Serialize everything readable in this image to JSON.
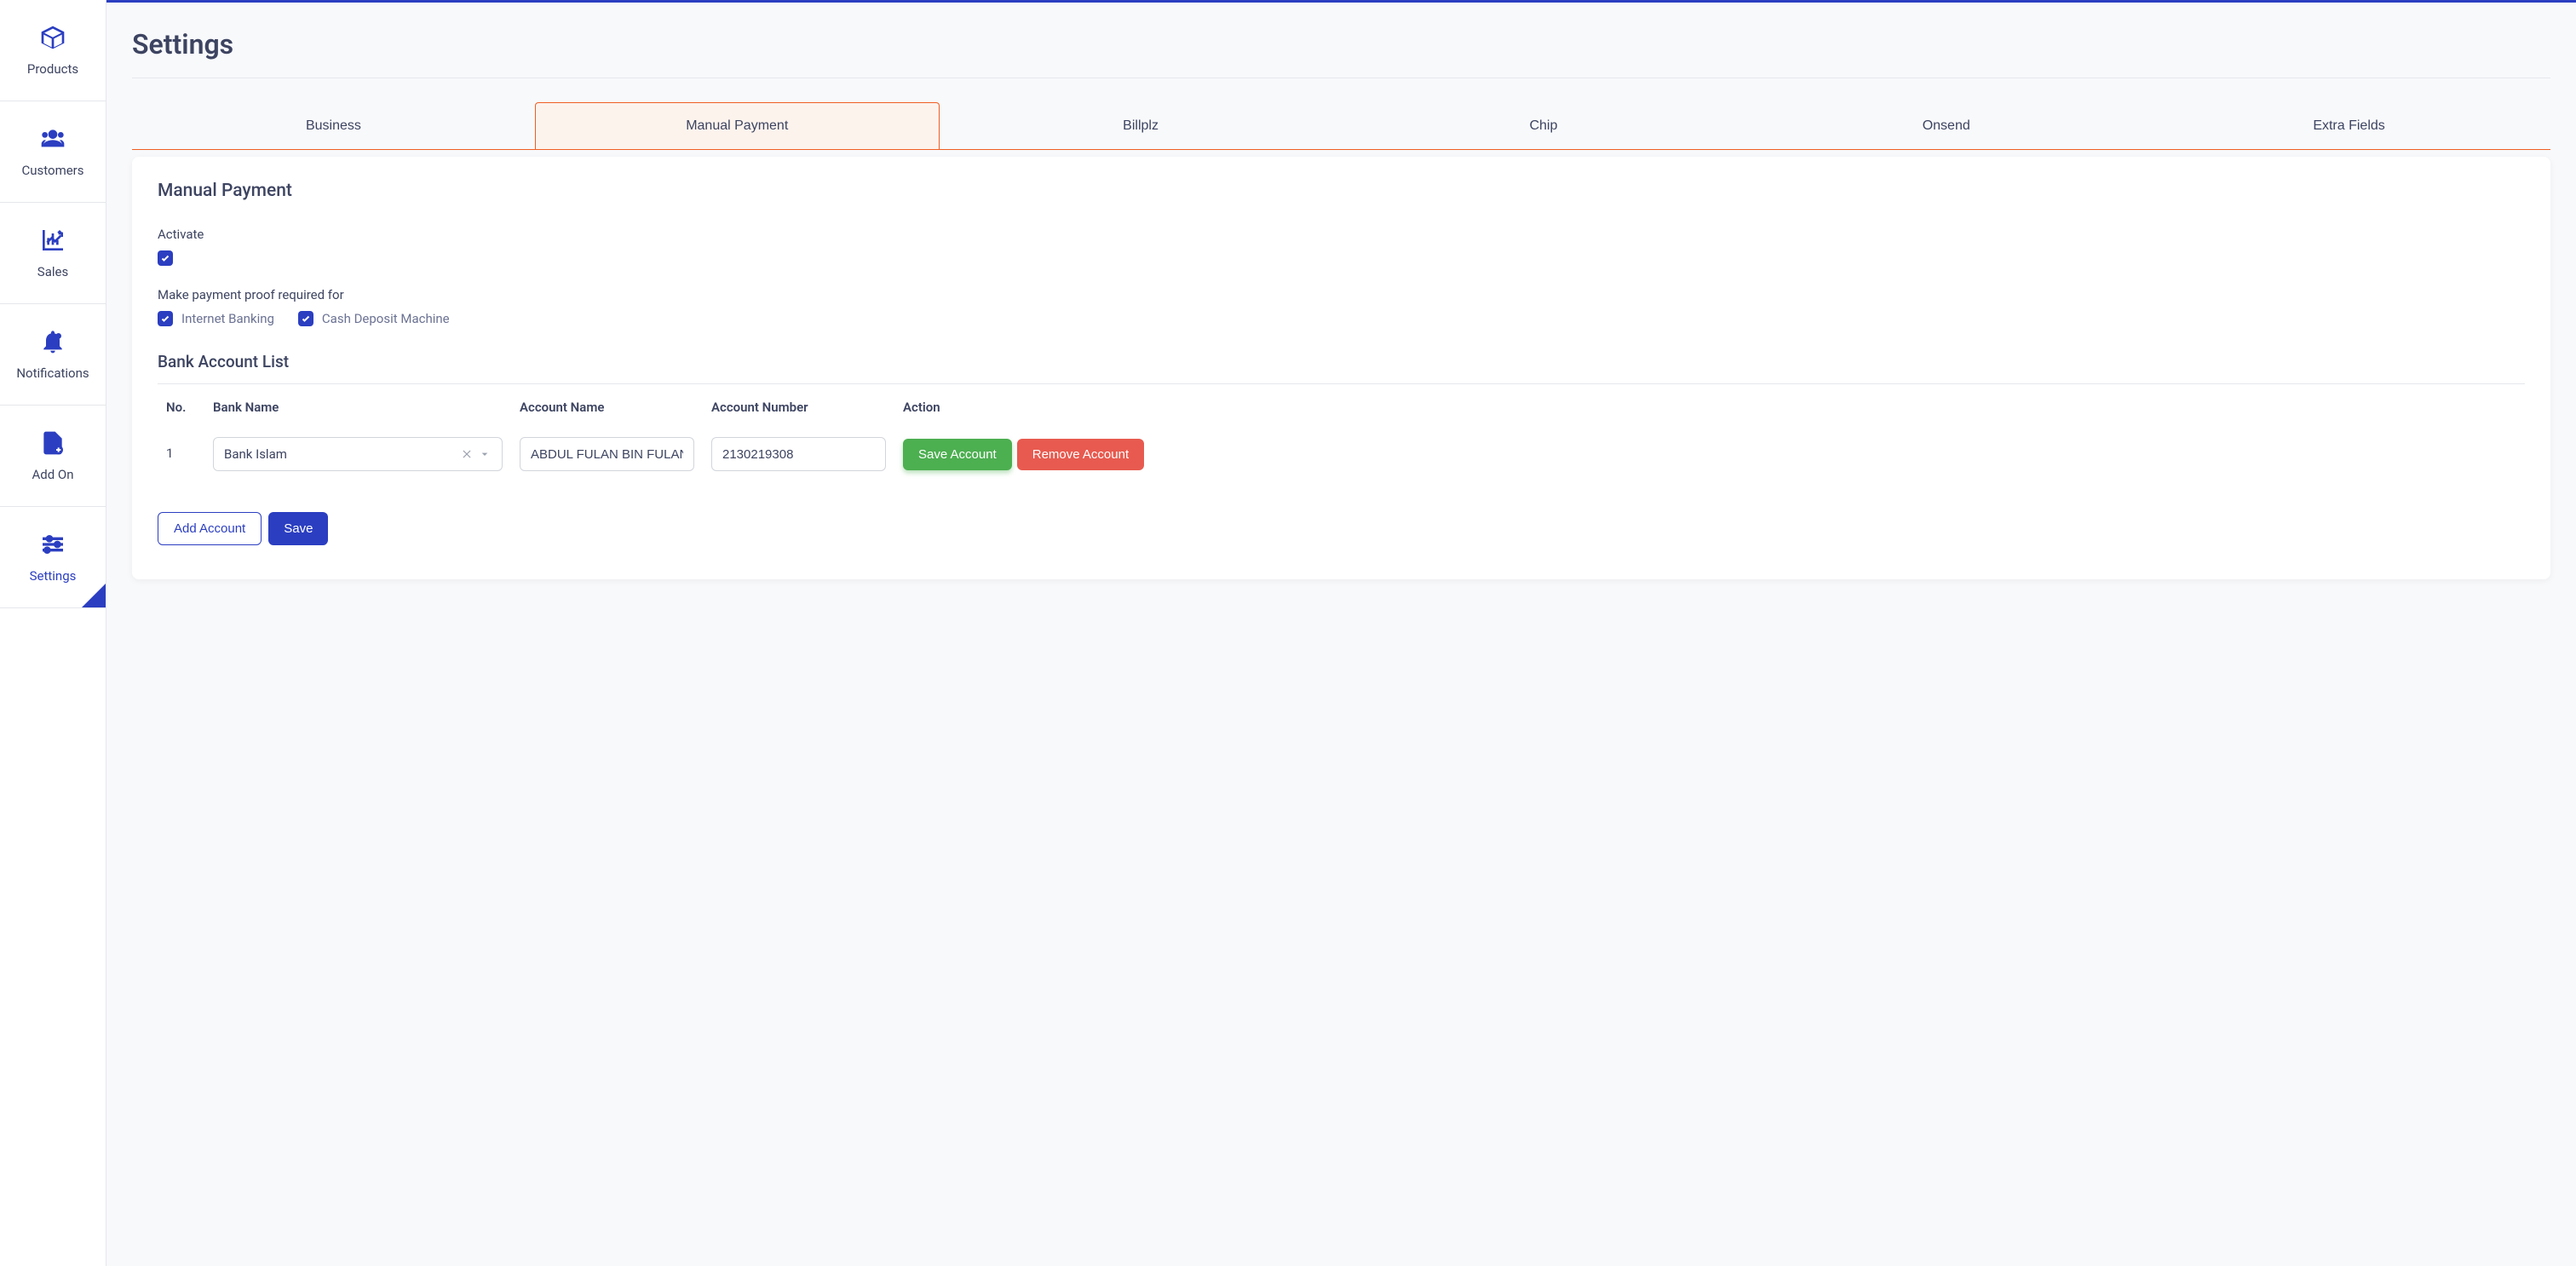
{
  "sidebar": {
    "items": [
      {
        "label": "Products",
        "icon": "box"
      },
      {
        "label": "Customers",
        "icon": "users"
      },
      {
        "label": "Sales",
        "icon": "chart"
      },
      {
        "label": "Notifications",
        "icon": "bell"
      },
      {
        "label": "Add On",
        "icon": "file-plus"
      },
      {
        "label": "Settings",
        "icon": "sliders",
        "active": true
      }
    ]
  },
  "page": {
    "title": "Settings"
  },
  "tabs": [
    {
      "label": "Business"
    },
    {
      "label": "Manual Payment",
      "active": true
    },
    {
      "label": "Billplz"
    },
    {
      "label": "Chip"
    },
    {
      "label": "Onsend"
    },
    {
      "label": "Extra Fields"
    }
  ],
  "manual_payment": {
    "title": "Manual Payment",
    "activate": {
      "label": "Activate",
      "checked": true
    },
    "proof_required": {
      "label": "Make payment proof required for",
      "options": [
        {
          "label": "Internet Banking",
          "checked": true
        },
        {
          "label": "Cash Deposit Machine",
          "checked": true
        }
      ]
    },
    "bank_list": {
      "title": "Bank Account List",
      "headers": {
        "no": "No.",
        "bank_name": "Bank Name",
        "account_name": "Account Name",
        "account_number": "Account Number",
        "action": "Action"
      },
      "rows": [
        {
          "no": "1",
          "bank_name": "Bank Islam",
          "account_name": "ABDUL FULAN BIN FULAN",
          "account_number": "2130219308"
        }
      ],
      "row_actions": {
        "save": "Save Account",
        "remove": "Remove Account"
      }
    },
    "buttons": {
      "add_account": "Add Account",
      "save": "Save"
    }
  }
}
